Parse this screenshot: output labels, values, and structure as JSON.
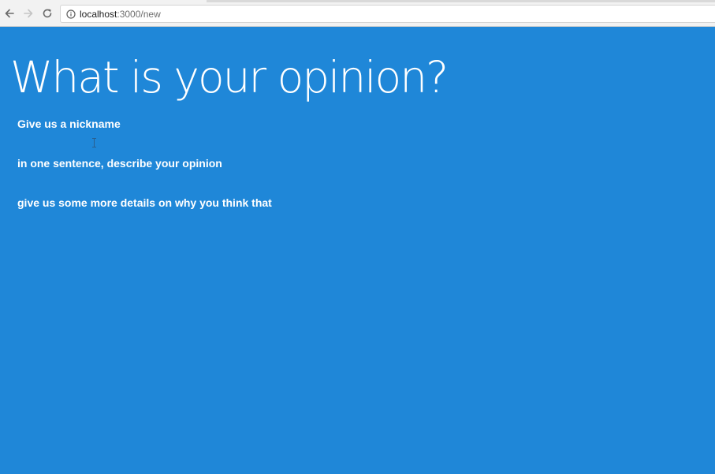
{
  "browser": {
    "url_host": "localhost",
    "url_path": ":3000/new",
    "icons": {
      "back": "arrow-left-icon",
      "forward": "arrow-right-icon",
      "reload": "reload-icon",
      "info": "info-icon"
    }
  },
  "page": {
    "background_color": "#1f87d8",
    "title": "What is your opinion?",
    "labels": {
      "nickname": "Give us a nickname",
      "opinion": "in one sentence, describe your opinion",
      "details": "give us some more details on why you think that"
    }
  }
}
